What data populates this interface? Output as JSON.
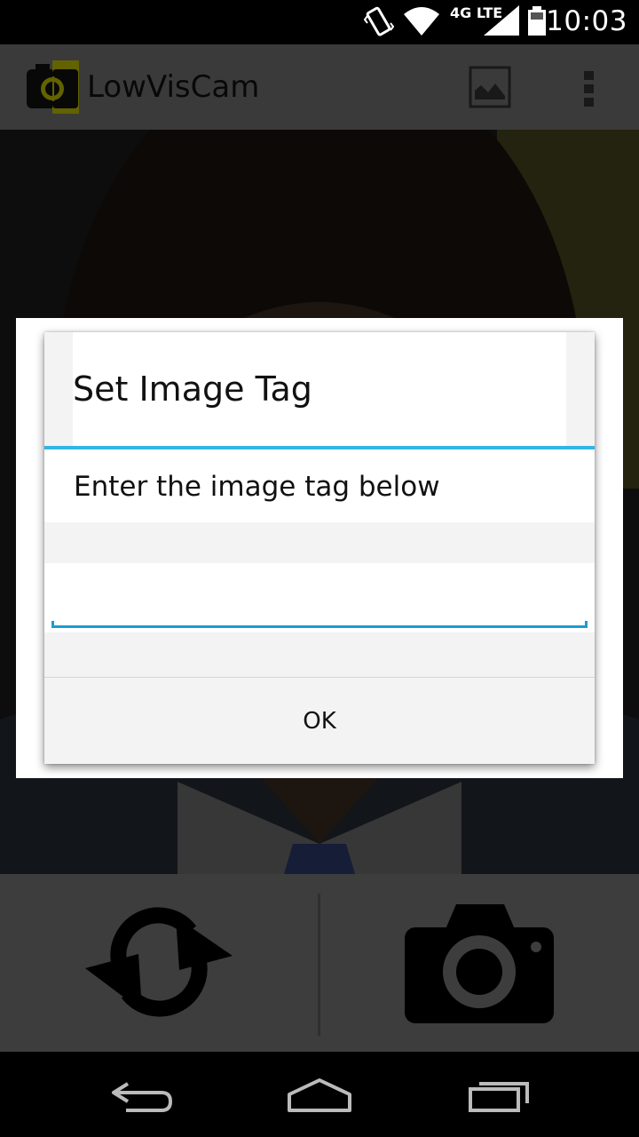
{
  "status_bar": {
    "network": "4G LTE",
    "time": "10:03"
  },
  "action_bar": {
    "app_title": "LowVisCam",
    "app_icon": "camera-logo-icon",
    "gallery_icon": "gallery-icon",
    "overflow_icon": "overflow-menu-icon"
  },
  "dialog": {
    "title": "Set Image Tag",
    "message": "Enter the image tag below",
    "input_value": "",
    "ok_label": "OK"
  },
  "controls": {
    "switch_camera_icon": "switch-camera-icon",
    "capture_icon": "capture-camera-icon"
  },
  "nav_bar": {
    "back_icon": "back-icon",
    "home_icon": "home-icon",
    "recents_icon": "recents-icon"
  },
  "colors": {
    "accent": "#33b5e5",
    "input_underline": "#1d9ccf",
    "action_bar": "#757575",
    "logo_yellow": "#c4c400"
  }
}
